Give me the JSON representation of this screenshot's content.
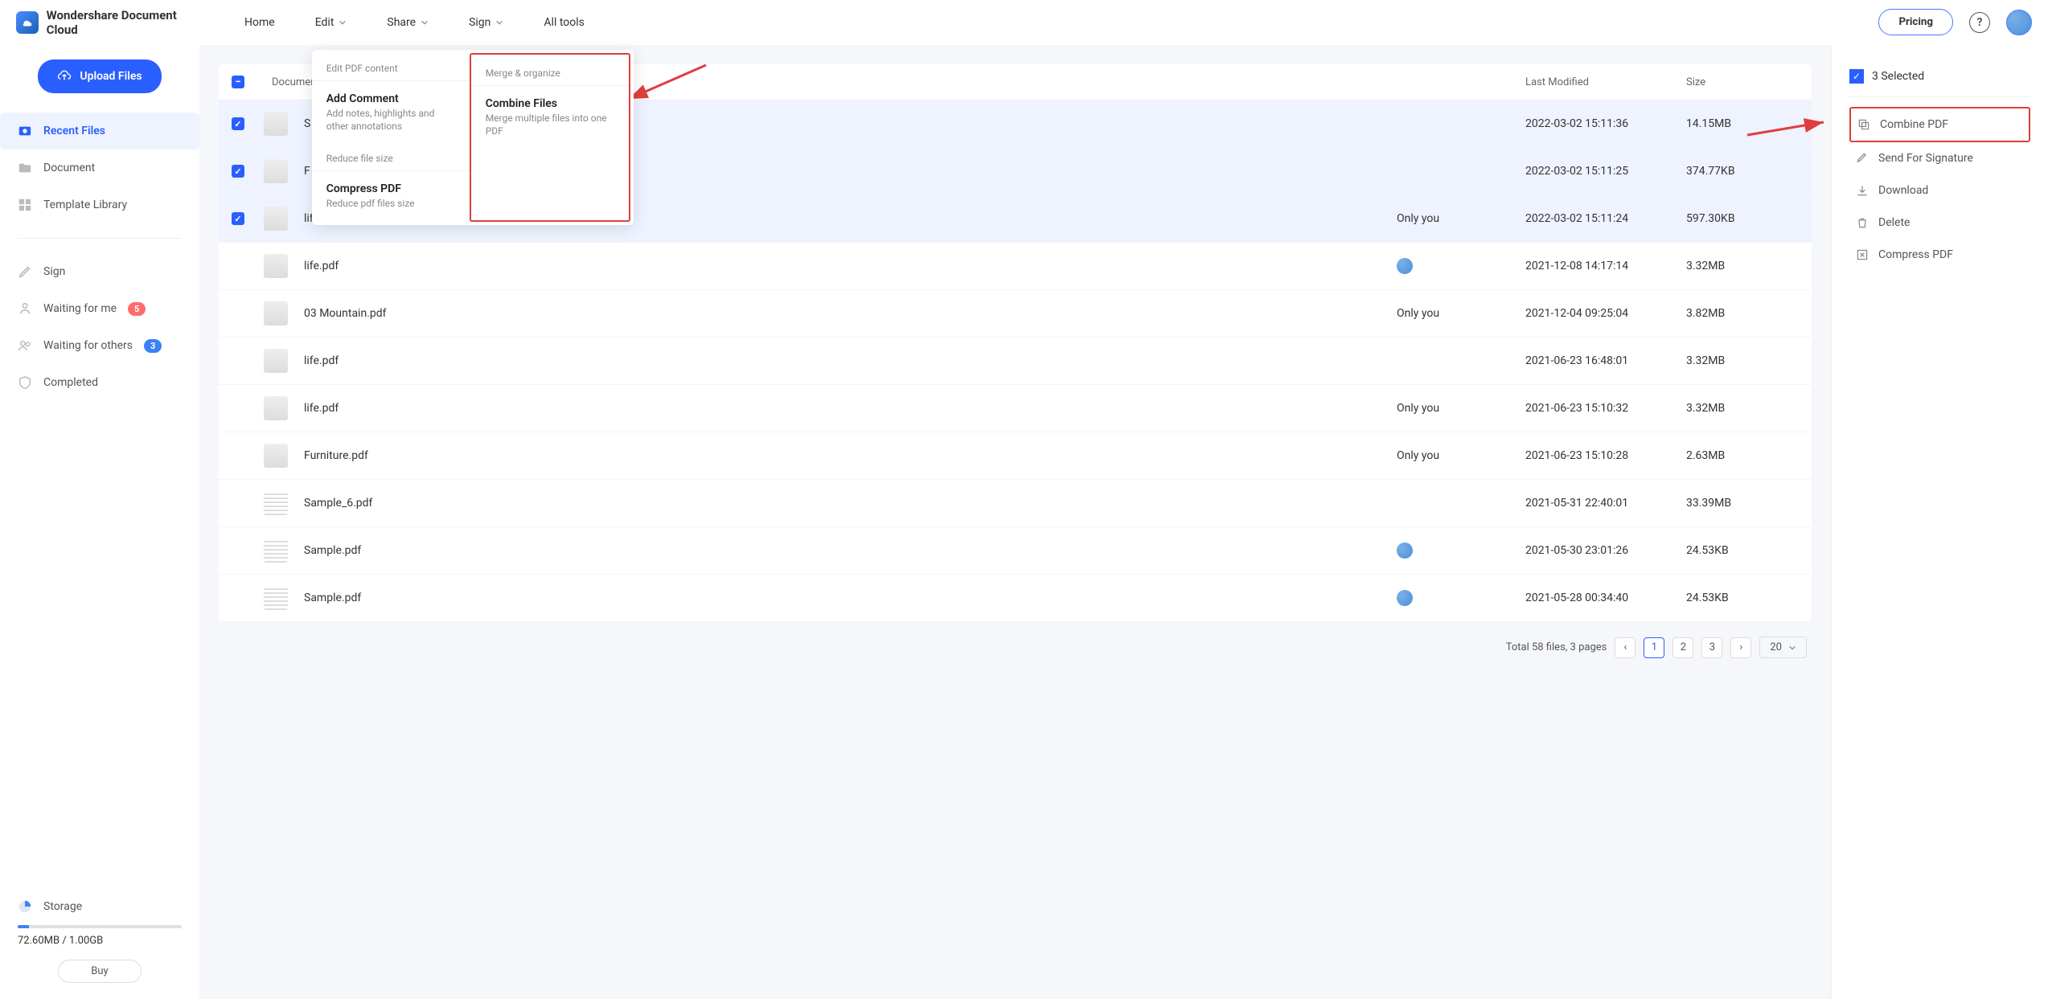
{
  "brand": "Wondershare Document Cloud",
  "topnav": {
    "home": "Home",
    "edit": "Edit",
    "share": "Share",
    "sign": "Sign",
    "all_tools": "All tools"
  },
  "header": {
    "pricing": "Pricing"
  },
  "upload_label": "Upload Files",
  "sidebar": {
    "recent": "Recent Files",
    "document": "Document",
    "template": "Template Library",
    "sign": "Sign",
    "waiting_me": "Waiting for me",
    "waiting_me_badge": "5",
    "waiting_others": "Waiting for others",
    "waiting_others_badge": "3",
    "completed": "Completed",
    "storage_label": "Storage",
    "storage_text": "72.60MB / 1.00GB",
    "buy": "Buy"
  },
  "columns": {
    "name": "Document Name",
    "modified": "Last Modified",
    "size": "Size"
  },
  "files": [
    {
      "name": "S",
      "shared": "",
      "modified": "2022-03-02 15:11:36",
      "size": "14.15MB",
      "checked": true
    },
    {
      "name": "F",
      "shared": "",
      "modified": "2022-03-02 15:11:25",
      "size": "374.77KB",
      "checked": true
    },
    {
      "name": "life_Compressed.pdf",
      "shared": "Only you",
      "modified": "2022-03-02 15:11:24",
      "size": "597.30KB",
      "checked": true
    },
    {
      "name": "life.pdf",
      "shared": "avatar",
      "modified": "2021-12-08 14:17:14",
      "size": "3.32MB",
      "checked": false
    },
    {
      "name": "03 Mountain.pdf",
      "shared": "Only you",
      "modified": "2021-12-04 09:25:04",
      "size": "3.82MB",
      "checked": false
    },
    {
      "name": "life.pdf",
      "shared": "",
      "modified": "2021-06-23 16:48:01",
      "size": "3.32MB",
      "checked": false
    },
    {
      "name": "life.pdf",
      "shared": "Only you",
      "modified": "2021-06-23 15:10:32",
      "size": "3.32MB",
      "checked": false
    },
    {
      "name": "Furniture.pdf",
      "shared": "Only you",
      "modified": "2021-06-23 15:10:28",
      "size": "2.63MB",
      "checked": false
    },
    {
      "name": "Sample_6.pdf",
      "shared": "",
      "modified": "2021-05-31 22:40:01",
      "size": "33.39MB",
      "checked": false
    },
    {
      "name": "Sample.pdf",
      "shared": "avatar",
      "modified": "2021-05-30 23:01:26",
      "size": "24.53KB",
      "checked": false
    },
    {
      "name": "Sample.pdf",
      "shared": "avatar",
      "modified": "2021-05-28 00:34:40",
      "size": "24.53KB",
      "checked": false
    }
  ],
  "dropdown": {
    "col1_label": "Edit PDF content",
    "col1_item1_title": "Add Comment",
    "col1_item1_desc": "Add notes, highlights and other annotations",
    "col1_label2": "Reduce file size",
    "col1_item2_title": "Compress PDF",
    "col1_item2_desc": "Reduce pdf files size",
    "col2_label": "Merge & organize",
    "col2_item1_title": "Combine Files",
    "col2_item1_desc": "Merge multiple files into one PDF"
  },
  "pagination": {
    "summary": "Total 58 files, 3 pages",
    "p1": "1",
    "p2": "2",
    "p3": "3",
    "page_size": "20"
  },
  "right": {
    "selected": "3 Selected",
    "combine": "Combine PDF",
    "send_sig": "Send For Signature",
    "download": "Download",
    "delete": "Delete",
    "compress": "Compress PDF"
  }
}
